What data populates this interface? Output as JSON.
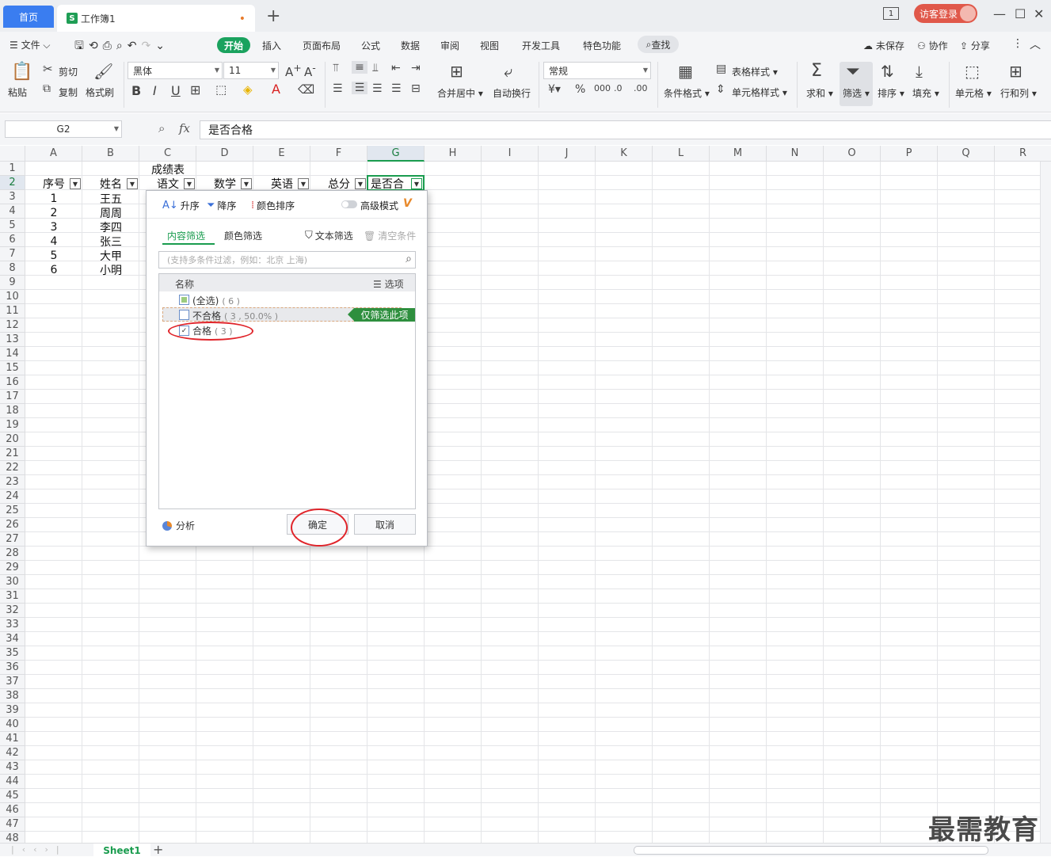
{
  "titlebar": {
    "home_tab": "首页",
    "workbook_tab": "工作簿1",
    "unsaved_dot": "•",
    "new_tab": "+",
    "page_badge": "1",
    "login": "访客登录",
    "min": "—",
    "max": "☐",
    "close": "✕"
  },
  "menubar": {
    "file": "文件",
    "start": "开始",
    "items": [
      "插入",
      "页面布局",
      "公式",
      "数据",
      "审阅",
      "视图",
      "开发工具",
      "特色功能"
    ],
    "search": "查找",
    "unsaved": "未保存",
    "collab": "协作",
    "share": "分享"
  },
  "ribbon": {
    "paste": "粘贴",
    "cut": "剪切",
    "copy": "复制",
    "format_painter": "格式刷",
    "font_name": "黑体",
    "font_size": "11",
    "number_format": "常规",
    "merge_center": "合并居中",
    "wrap": "自动换行",
    "cond_format": "条件格式",
    "table_style": "表格样式",
    "cell_style": "单元格样式",
    "sum": "求和",
    "filter": "筛选",
    "sort": "排序",
    "fill": "填充",
    "cell": "单元格",
    "row_col": "行和列"
  },
  "formula_bar": {
    "name_box": "G2",
    "fx": "fx",
    "content": "是否合格"
  },
  "grid": {
    "columns": [
      "A",
      "B",
      "C",
      "D",
      "E",
      "F",
      "G",
      "H",
      "I",
      "J",
      "K",
      "L",
      "M",
      "N",
      "O",
      "P",
      "Q",
      "R"
    ],
    "title": "成绩表",
    "headers": [
      "序号",
      "姓名",
      "语文",
      "数学",
      "英语",
      "总分",
      "是否合"
    ],
    "rows": [
      [
        "1",
        "王五"
      ],
      [
        "2",
        "周周"
      ],
      [
        "3",
        "李四"
      ],
      [
        "4",
        "张三"
      ],
      [
        "5",
        "大甲"
      ],
      [
        "6",
        "小明"
      ]
    ]
  },
  "filter_panel": {
    "asc": "升序",
    "desc": "降序",
    "color_sort": "颜色排序",
    "advanced": "高级模式",
    "tab_content": "内容筛选",
    "tab_color": "颜色筛选",
    "text_filter": "文本筛选",
    "clear": "清空条件",
    "search_placeholder": "(支持多条件过滤，例如：北京  上海)",
    "list_header": "名称",
    "options": "选项",
    "items": [
      {
        "label": "(全选)",
        "count": "( 6 )",
        "state": "partial"
      },
      {
        "label": "不合格",
        "count": "( 3 , 50.0% )",
        "state": "unchecked"
      },
      {
        "label": "合格",
        "count": "( 3 )",
        "state": "checked"
      }
    ],
    "only_this": "仅筛选此项",
    "analyze": "分析",
    "ok": "确定",
    "cancel": "取消"
  },
  "sheetbar": {
    "sheet": "Sheet1",
    "add": "+"
  },
  "watermark": "最需教育",
  "colors": {
    "accent_green": "#1a9c4f",
    "home_blue": "#3a7df0",
    "login_red": "#e0584a",
    "annotation_red": "#e0242a"
  }
}
